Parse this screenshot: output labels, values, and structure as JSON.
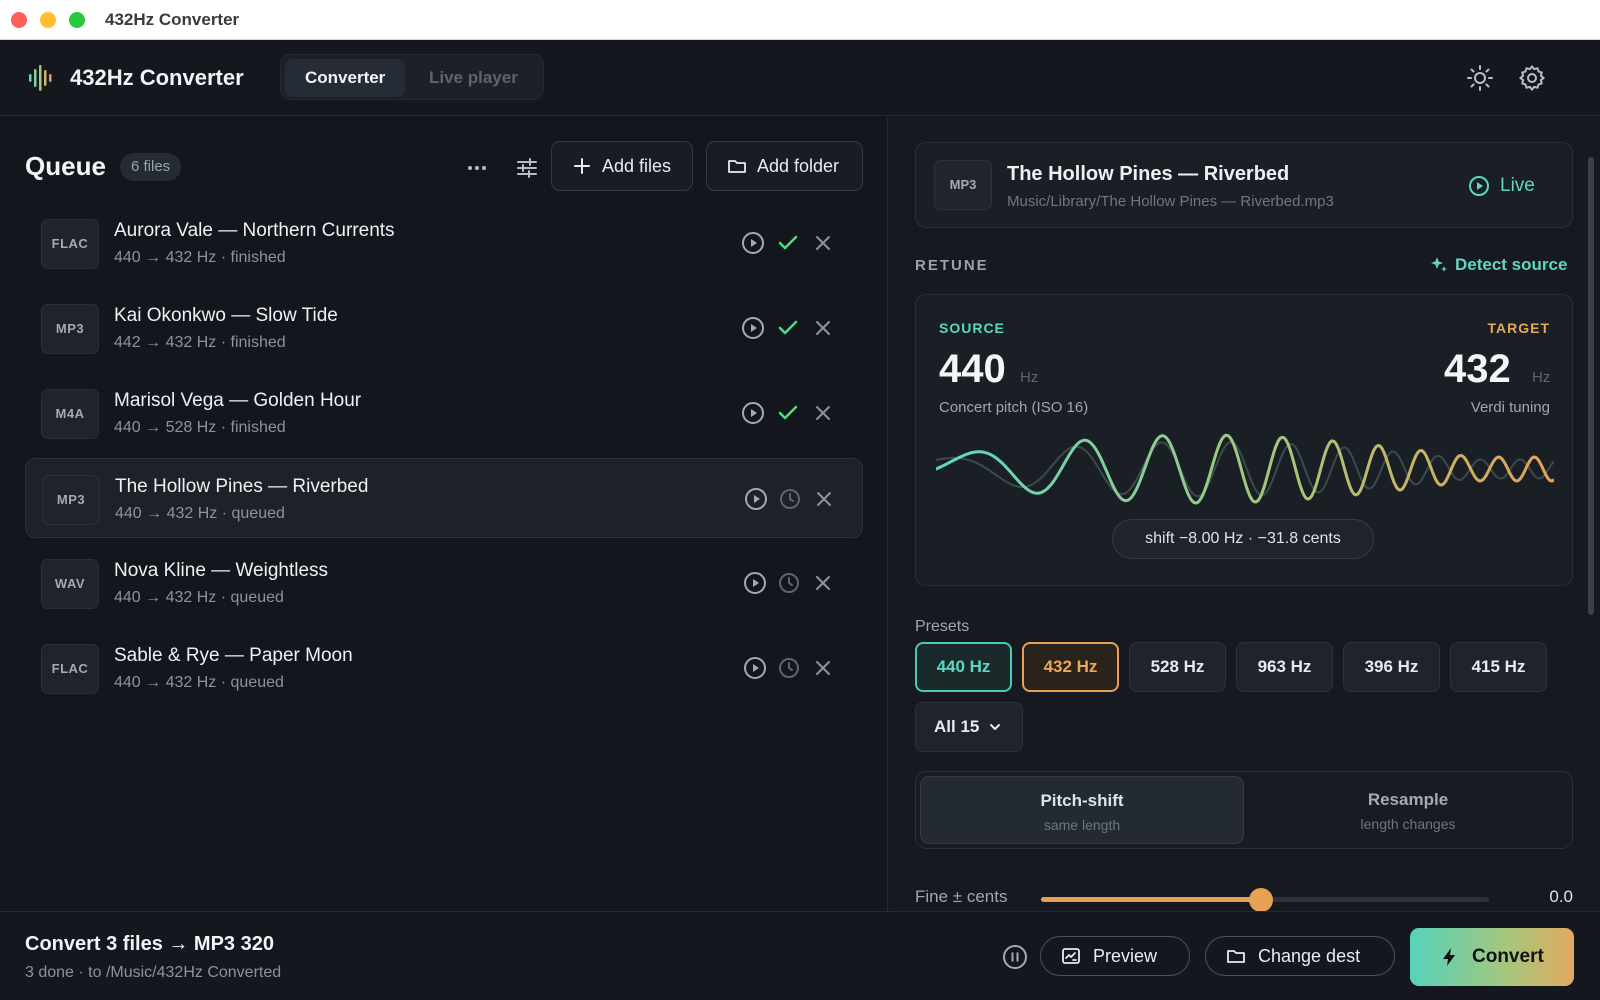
{
  "window": {
    "title": "432Hz Converter"
  },
  "header": {
    "app_title": "432Hz Converter",
    "tabs": [
      {
        "label": "Converter",
        "active": true
      },
      {
        "label": "Live player",
        "active": false
      }
    ],
    "icons": [
      "sun-icon",
      "gear-icon"
    ]
  },
  "queue": {
    "title": "Queue",
    "count_badge": "6 files",
    "add_files_label": "Add files",
    "add_folder_label": "Add folder",
    "items": [
      {
        "format": "FLAC",
        "title": "Aurora Vale — Northern Currents",
        "subtitle": "440 → 432 Hz · finished",
        "status": "finished"
      },
      {
        "format": "MP3",
        "title": "Kai Okonkwo — Slow Tide",
        "subtitle": "442 → 432 Hz · finished",
        "status": "finished"
      },
      {
        "format": "M4A",
        "title": "Marisol Vega — Golden Hour",
        "subtitle": "440 → 528 Hz · finished",
        "status": "finished"
      },
      {
        "format": "MP3",
        "title": "The Hollow Pines — Riverbed",
        "subtitle": "440 → 432 Hz · queued",
        "status": "queued",
        "selected": true
      },
      {
        "format": "WAV",
        "title": "Nova Kline — Weightless",
        "subtitle": "440 → 432 Hz · queued",
        "status": "queued"
      },
      {
        "format": "FLAC",
        "title": "Sable & Rye — Paper Moon",
        "subtitle": "440 → 432 Hz · queued",
        "status": "queued"
      }
    ]
  },
  "now": {
    "format": "MP3",
    "title": "The Hollow Pines — Riverbed",
    "path": "Music/Library/The Hollow Pines — Riverbed.mp3",
    "live_label": "Live"
  },
  "retune": {
    "section_label": "RETUNE",
    "detect_label": "Detect source",
    "source_label": "SOURCE",
    "target_label": "TARGET",
    "source_value": "440",
    "target_value": "432",
    "unit": "Hz",
    "source_desc": "Concert pitch (ISO 16)",
    "target_desc": "Verdi tuning",
    "shift_text": "shift −8.00 Hz · −31.8 cents"
  },
  "presets": {
    "label": "Presets",
    "items": [
      "440 Hz",
      "432 Hz",
      "528 Hz",
      "963 Hz",
      "396 Hz",
      "415 Hz"
    ],
    "all_label": "All 15"
  },
  "mode": {
    "options": [
      {
        "title": "Pitch-shift",
        "subtitle": "same length",
        "active": true
      },
      {
        "title": "Resample",
        "subtitle": "length changes",
        "active": false
      }
    ]
  },
  "fine": {
    "label": "Fine ± cents",
    "value": "0.0",
    "position_fraction": 0.49
  },
  "bottom": {
    "title": "Convert 3 files → MP3 320",
    "subtitle": "3 done · to /Music/432Hz Converted",
    "preview_label": "Preview",
    "change_dest_label": "Change dest",
    "convert_label": "Convert"
  },
  "colors": {
    "accent_source": "#5ed7c2",
    "accent_target": "#e6a154",
    "success": "#4ade80",
    "background": "#13171d"
  }
}
